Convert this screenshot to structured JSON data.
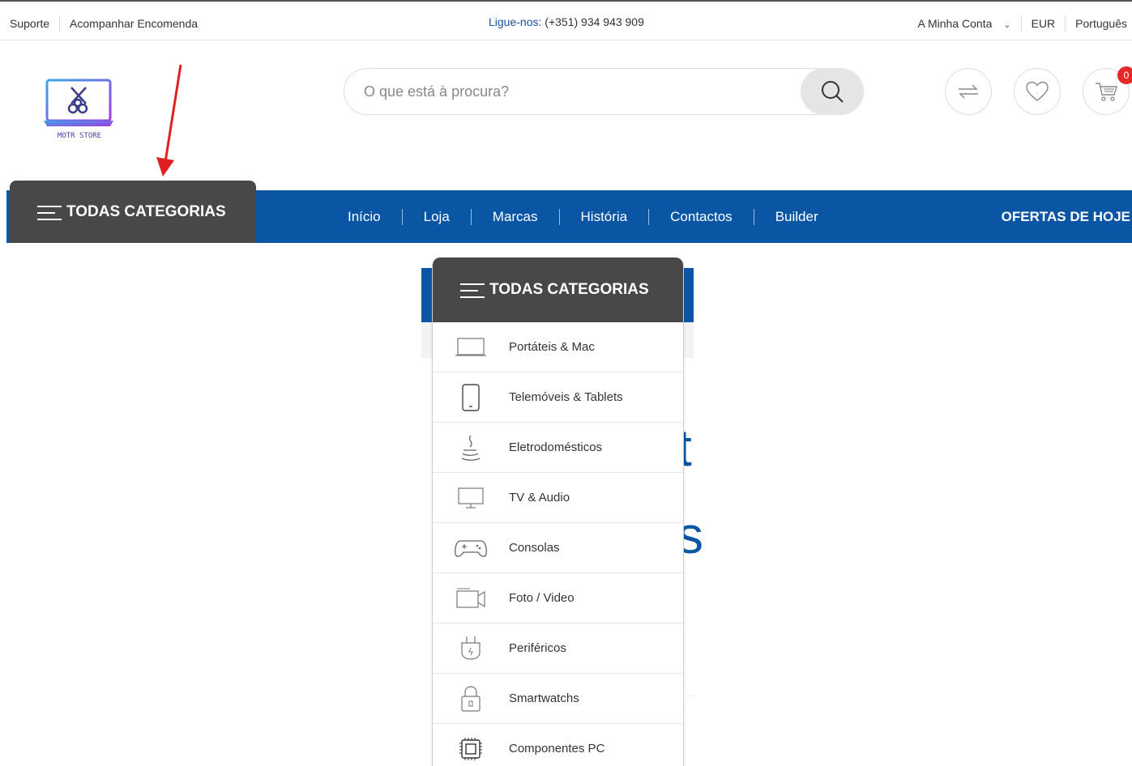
{
  "topbar": {
    "support": "Suporte",
    "track_order": "Acompanhar Encomenda",
    "phone_label": "Ligue-nos:",
    "phone_number": " (+351) 934 943 909",
    "account": "A Minha Conta",
    "currency": "EUR",
    "language": "Português"
  },
  "logo": {
    "text": "MOTR STORE"
  },
  "search": {
    "placeholder": "O que está à procura?"
  },
  "header_icons": {
    "compare": "compare-icon",
    "wishlist": "heart-icon",
    "cart": "cart-icon",
    "cart_count": "0"
  },
  "nav": {
    "categories_label": "TODAS CATEGORIAS",
    "items": [
      "Início",
      "Loja",
      "Marcas",
      "História",
      "Contactos",
      "Builder"
    ],
    "offers": "OFERTAS DE HOJE"
  },
  "dropdown": {
    "title": "TODAS CATEGORIAS",
    "items": [
      {
        "label": "Portáteis & Mac",
        "icon": "laptop-icon"
      },
      {
        "label": "Telemóveis & Tablets",
        "icon": "phone-icon"
      },
      {
        "label": "Eletrodomésticos",
        "icon": "appliance-icon"
      },
      {
        "label": "TV & Audio",
        "icon": "tv-icon"
      },
      {
        "label": "Consolas",
        "icon": "gamepad-icon"
      },
      {
        "label": "Foto / Video",
        "icon": "camera-icon"
      },
      {
        "label": "Periféricos",
        "icon": "plug-icon"
      },
      {
        "label": "Smartwatchs",
        "icon": "lock-icon"
      },
      {
        "label": "Componentes PC",
        "icon": "chip-icon"
      }
    ]
  },
  "colors": {
    "brand_blue": "#0b56a4",
    "dark_tab": "#484848",
    "badge_red": "#e52727",
    "arrow_red": "#e02020"
  }
}
